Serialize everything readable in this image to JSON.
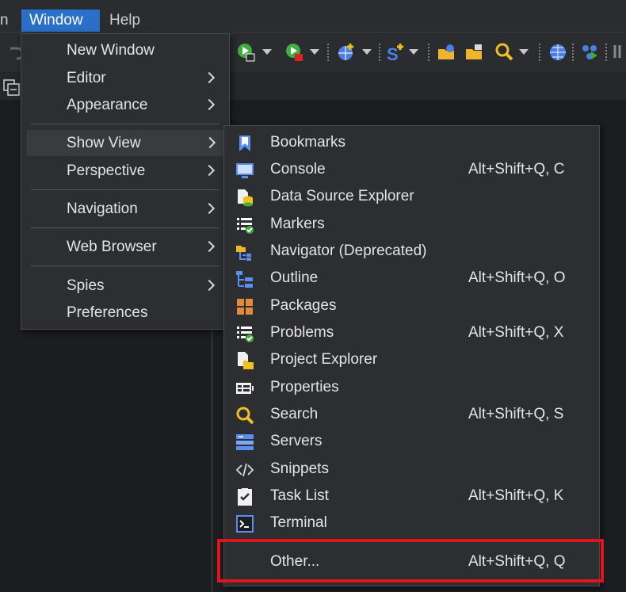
{
  "menubar": {
    "partial_left": "n",
    "window_label": "Window",
    "help_label": "Help"
  },
  "window_menu": {
    "items": [
      {
        "label": "New Window",
        "submenu": false
      },
      {
        "label": "Editor",
        "submenu": true
      },
      {
        "label": "Appearance",
        "submenu": true
      },
      {
        "label": "Show View",
        "submenu": true,
        "highlighted": true
      },
      {
        "label": "Perspective",
        "submenu": true
      },
      {
        "label": "Navigation",
        "submenu": true
      },
      {
        "label": "Web Browser",
        "submenu": true
      },
      {
        "label": "Spies",
        "submenu": true
      },
      {
        "label": "Preferences",
        "submenu": false
      }
    ]
  },
  "show_view_menu": {
    "items": [
      {
        "label": "Bookmarks",
        "shortcut": "",
        "icon": "bookmark-icon"
      },
      {
        "label": "Console",
        "shortcut": "Alt+Shift+Q, C",
        "icon": "console-icon"
      },
      {
        "label": "Data Source Explorer",
        "shortcut": "",
        "icon": "data-source-icon"
      },
      {
        "label": "Markers",
        "shortcut": "",
        "icon": "markers-icon"
      },
      {
        "label": "Navigator (Deprecated)",
        "shortcut": "",
        "icon": "navigator-icon"
      },
      {
        "label": "Outline",
        "shortcut": "Alt+Shift+Q, O",
        "icon": "outline-icon"
      },
      {
        "label": "Packages",
        "shortcut": "",
        "icon": "packages-icon"
      },
      {
        "label": "Problems",
        "shortcut": "Alt+Shift+Q, X",
        "icon": "problems-icon"
      },
      {
        "label": "Project Explorer",
        "shortcut": "",
        "icon": "project-explorer-icon"
      },
      {
        "label": "Properties",
        "shortcut": "",
        "icon": "properties-icon"
      },
      {
        "label": "Search",
        "shortcut": "Alt+Shift+Q, S",
        "icon": "search-icon"
      },
      {
        "label": "Servers",
        "shortcut": "",
        "icon": "servers-icon"
      },
      {
        "label": "Snippets",
        "shortcut": "",
        "icon": "snippets-icon"
      },
      {
        "label": "Task List",
        "shortcut": "Alt+Shift+Q, K",
        "icon": "task-list-icon"
      },
      {
        "label": "Terminal",
        "shortcut": "",
        "icon": "terminal-icon"
      }
    ],
    "other": {
      "label": "Other...",
      "shortcut": "Alt+Shift+Q, Q"
    }
  },
  "colors": {
    "menu_bg": "#2d2e31",
    "selected_menubar": "#2a6fc9",
    "annotation_red": "#e0141a"
  }
}
